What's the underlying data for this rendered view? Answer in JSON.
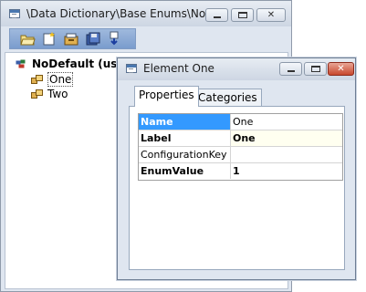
{
  "aot_window": {
    "title": "\\Data Dictionary\\Base Enums\\No...",
    "controls": {
      "minimize": "minimize",
      "maximize": "maximize",
      "close": "close"
    }
  },
  "toolbar": {
    "buttons": [
      "open-icon",
      "new-icon",
      "properties-icon",
      "save-all-icon",
      "compile-icon"
    ]
  },
  "tree": {
    "root": "NoDefault (usr)",
    "items": [
      {
        "label": "One",
        "selected": true
      },
      {
        "label": "Two",
        "selected": false
      }
    ]
  },
  "property_window": {
    "title": "Element One",
    "tabs": [
      {
        "label": "Properties",
        "active": true
      },
      {
        "label": "Categories",
        "active": false
      }
    ],
    "properties": [
      {
        "name": "Name",
        "value": "One"
      },
      {
        "name": "Label",
        "value": "One"
      },
      {
        "name": "ConfigurationKey",
        "value": ""
      },
      {
        "name": "EnumValue",
        "value": "1"
      }
    ]
  },
  "colors": {
    "selection": "#3399ff",
    "close_button": "#c7472d",
    "toolbar": "#7a9ccd"
  }
}
